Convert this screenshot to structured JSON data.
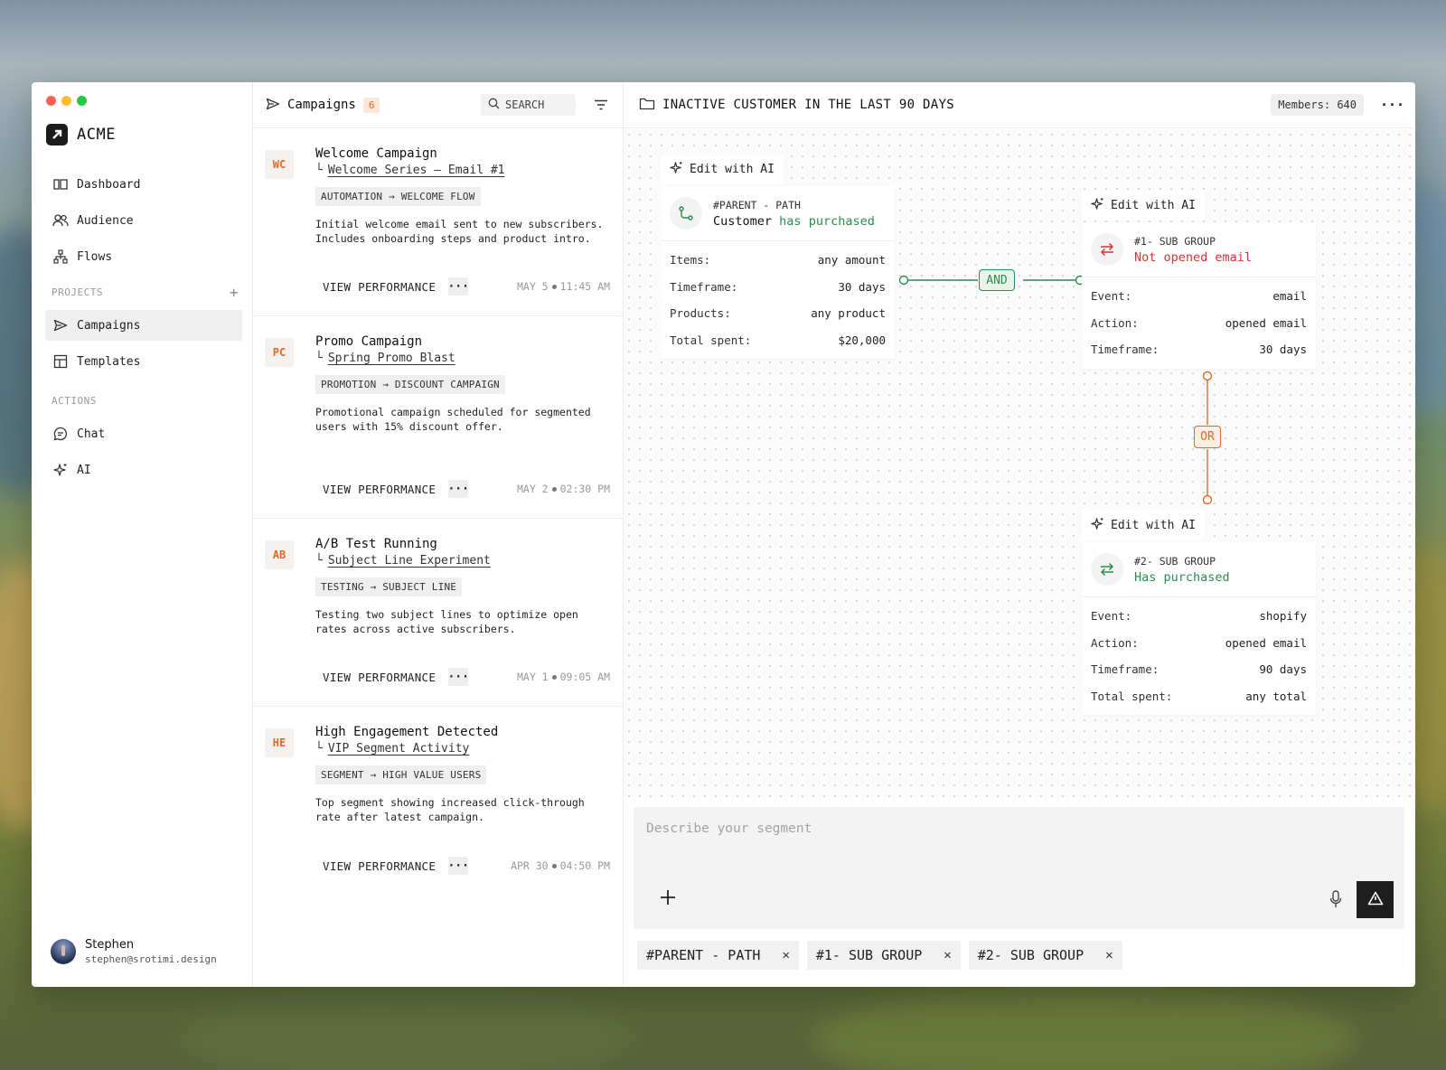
{
  "app": {
    "brand": "ACME"
  },
  "sidebar": {
    "items": [
      {
        "label": "Dashboard"
      },
      {
        "label": "Audience"
      },
      {
        "label": "Flows"
      }
    ],
    "projects_label": "PROJECTS",
    "project_items": [
      {
        "label": "Campaigns"
      },
      {
        "label": "Templates"
      }
    ],
    "actions_label": "ACTIONS",
    "action_items": [
      {
        "label": "Chat"
      },
      {
        "label": "AI"
      }
    ],
    "user": {
      "name": "Stephen",
      "email": "stephen@srotimi.design"
    }
  },
  "list": {
    "title": "Campaigns",
    "count": "6",
    "search_label": "SEARCH",
    "cards": [
      {
        "initials": "WC",
        "title": "Welcome Campaign",
        "subtitle": "Welcome Series – Email #1",
        "tag": "AUTOMATION → WELCOME FLOW",
        "description": "Initial welcome email sent to new subscribers. Includes onboarding steps and product intro.",
        "action": "VIEW PERFORMANCE",
        "date": "MAY 5",
        "time": "11:45 AM"
      },
      {
        "initials": "PC",
        "title": "Promo Campaign",
        "subtitle": "Spring Promo Blast",
        "tag": "PROMOTION → DISCOUNT CAMPAIGN",
        "description": "Promotional campaign scheduled for segmented users with 15% discount offer.",
        "action": "VIEW PERFORMANCE",
        "date": "MAY 2",
        "time": "02:30 PM"
      },
      {
        "initials": "AB",
        "title": "A/B Test Running",
        "subtitle": "Subject Line Experiment",
        "tag": "TESTING → SUBJECT LINE",
        "description": "Testing two subject lines to optimize open rates across active subscribers.",
        "action": "VIEW PERFORMANCE",
        "date": "MAY 1",
        "time": "09:05 AM"
      },
      {
        "initials": "HE",
        "title": "High Engagement Detected",
        "subtitle": "VIP Segment Activity",
        "tag": "SEGMENT → HIGH VALUE USERS",
        "description": "Top segment showing increased click-through rate after latest campaign.",
        "action": "VIEW PERFORMANCE",
        "date": "APR 30",
        "time": "04:50 PM"
      }
    ]
  },
  "main": {
    "title": "INACTIVE CUSTOMER IN THE LAST 90 DAYS",
    "members_label": "Members:",
    "members_count": "640",
    "edit_ai_label": "Edit with AI",
    "and_label": "AND",
    "or_label": "OR",
    "parent": {
      "kicker": "#PARENT - PATH",
      "title_a": "Customer",
      "title_b": "has",
      "title_c": "purchased",
      "rows": [
        {
          "k": "Items:",
          "v": "any amount"
        },
        {
          "k": "Timeframe:",
          "v": "30 days"
        },
        {
          "k": "Products:",
          "v": "any product"
        },
        {
          "k": "Total spent:",
          "v": "$20,000"
        }
      ]
    },
    "sub1": {
      "kicker": "#1- SUB GROUP",
      "title": "Not opened email",
      "rows": [
        {
          "k": "Event:",
          "v": "email"
        },
        {
          "k": "Action:",
          "v": "opened email"
        },
        {
          "k": "Timeframe:",
          "v": "30 days"
        }
      ]
    },
    "sub2": {
      "kicker": "#2- SUB GROUP",
      "title": "Has purchased",
      "rows": [
        {
          "k": "Event:",
          "v": "shopify"
        },
        {
          "k": "Action:",
          "v": "opened email"
        },
        {
          "k": "Timeframe:",
          "v": "90 days"
        },
        {
          "k": "Total spent:",
          "v": "any total"
        }
      ]
    },
    "composer": {
      "placeholder": "Describe your segment"
    },
    "chips": [
      {
        "label": "#PARENT - PATH"
      },
      {
        "label": "#1- SUB GROUP"
      },
      {
        "label": "#2- SUB GROUP"
      }
    ]
  },
  "colors": {
    "accent_orange": "#e2692a",
    "and_green": "#2e8b4e",
    "red": "#d93232"
  }
}
